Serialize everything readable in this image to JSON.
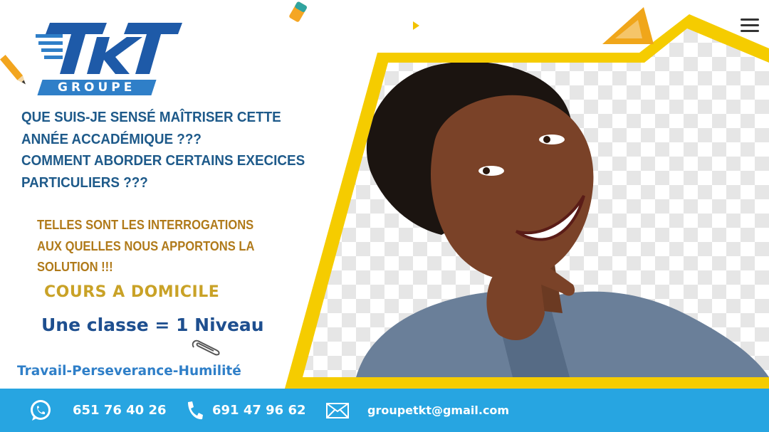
{
  "brand": {
    "logo_text": "TKT",
    "groupe_label": "GROUPE"
  },
  "questions": [
    "QUE SUIS-JE SENSÉ MAÎTRISER CETTE",
    "ANNÉE ACCADÉMIQUE ???",
    "COMMENT ABORDER CERTAINS EXECICES",
    "PARTICULIERS ???"
  ],
  "answer": [
    "TELLES SONT LES INTERROGATIONS",
    "AUX QUELLES NOUS APPORTONS LA",
    "SOLUTION !!!"
  ],
  "service": "COURS A DOMICILE",
  "tagline": "Une classe = 1 Niveau",
  "motto": "Travail-Perseverance-Humilité",
  "contacts": {
    "whatsapp": "651 76 40 26",
    "phone": "691 47 96 62",
    "email": "groupetkt@gmail.com"
  },
  "colors": {
    "primary_blue": "#1e5a8a",
    "footer_blue": "#27a5e1",
    "gold": "#c9a227",
    "frame_yellow": "#f5cc00"
  }
}
